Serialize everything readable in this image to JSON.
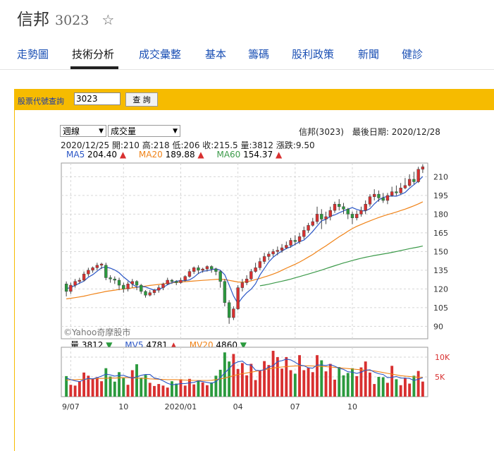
{
  "header": {
    "stock_name": "信邦",
    "stock_code": "3023"
  },
  "tabs": [
    {
      "label": "走勢圖",
      "active": false
    },
    {
      "label": "技術分析",
      "active": true
    },
    {
      "label": "成交彙整",
      "active": false
    },
    {
      "label": "基本",
      "active": false
    },
    {
      "label": "籌碼",
      "active": false
    },
    {
      "label": "股利政策",
      "active": false
    },
    {
      "label": "新聞",
      "active": false
    },
    {
      "label": "健診",
      "active": false
    }
  ],
  "query": {
    "label": "股票代號查詢",
    "value": "3023",
    "button": "查 詢"
  },
  "controls": {
    "period": "週線",
    "indicator": "成交量"
  },
  "info": {
    "title_date": "信邦(3023)　最後日期: 2020/12/28",
    "ohlc": "2020/12/25  開:210  高:218  低:206  收:215.5  量:3812  漲跌:9.50"
  },
  "ma_legend": [
    {
      "label": "MA5",
      "value": "204.40",
      "color": "#2a56c6",
      "dir": "▲"
    },
    {
      "label": "MA20",
      "value": "189.88",
      "color": "#f08318",
      "dir": "▲"
    },
    {
      "label": "MA60",
      "value": "154.37",
      "color": "#3c9a4a",
      "dir": "▲"
    }
  ],
  "vol_legend": [
    {
      "label": "量",
      "value": "3812",
      "color": "#222222",
      "dir": "▼"
    },
    {
      "label": "MV5",
      "value": "4781",
      "color": "#2a56c6",
      "dir": "▲"
    },
    {
      "label": "MV20",
      "value": "4860",
      "color": "#f08318",
      "dir": "▼"
    }
  ],
  "watermark": "©Yahoo奇摩股市",
  "colors": {
    "up": "#d83030",
    "down": "#2b9a3e",
    "query_bar": "#f6bb00",
    "tab_link": "#1a4fb4"
  },
  "chart_data": [
    {
      "type": "candlestick",
      "price_ticks": [
        90,
        105,
        120,
        135,
        150,
        165,
        180,
        195,
        210
      ],
      "ylim": [
        80,
        221
      ],
      "x_ticks": [
        "9/07",
        "10",
        "2020/01",
        "04",
        "07",
        "10"
      ],
      "grid": true,
      "candles": [
        [
          124,
          118,
          126,
          114
        ],
        [
          118,
          123,
          125,
          116
        ],
        [
          123,
          126,
          128,
          121
        ],
        [
          126,
          127,
          129,
          124
        ],
        [
          127,
          132,
          134,
          126
        ],
        [
          132,
          135,
          137,
          130
        ],
        [
          135,
          137,
          138,
          133
        ],
        [
          137,
          139,
          141,
          135
        ],
        [
          139,
          140,
          141,
          136
        ],
        [
          139,
          129,
          141,
          127
        ],
        [
          129,
          128,
          131,
          125
        ],
        [
          128,
          127,
          130,
          124
        ],
        [
          127,
          123,
          129,
          119
        ],
        [
          123,
          120,
          125,
          117
        ],
        [
          120,
          124,
          126,
          118
        ],
        [
          124,
          126,
          128,
          121
        ],
        [
          126,
          123,
          127,
          119
        ],
        [
          123,
          118,
          124,
          116
        ],
        [
          118,
          115,
          119,
          113
        ],
        [
          115,
          117,
          119,
          114
        ],
        [
          117,
          119,
          120,
          115
        ],
        [
          119,
          121,
          123,
          117
        ],
        [
          121,
          124,
          125,
          119
        ],
        [
          124,
          127,
          129,
          123
        ],
        [
          127,
          126,
          128,
          124
        ],
        [
          126,
          125,
          127,
          123
        ],
        [
          125,
          127,
          129,
          124
        ],
        [
          127,
          130,
          131,
          126
        ],
        [
          130,
          134,
          136,
          129
        ],
        [
          134,
          137,
          138,
          132
        ],
        [
          137,
          135,
          139,
          132
        ],
        [
          135,
          136,
          137,
          133
        ],
        [
          136,
          138,
          139,
          134
        ],
        [
          138,
          136,
          139,
          133
        ],
        [
          136,
          134,
          137,
          131
        ],
        [
          134,
          126,
          135,
          121
        ],
        [
          126,
          109,
          128,
          106
        ],
        [
          109,
          97,
          111,
          92
        ],
        [
          97,
          104,
          106,
          95
        ],
        [
          104,
          121,
          123,
          103
        ],
        [
          121,
          125,
          128,
          118
        ],
        [
          125,
          128,
          131,
          123
        ],
        [
          128,
          134,
          136,
          127
        ],
        [
          134,
          137,
          141,
          133
        ],
        [
          137,
          142,
          145,
          135
        ],
        [
          142,
          146,
          149,
          140
        ],
        [
          146,
          148,
          150,
          143
        ],
        [
          148,
          150,
          152,
          146
        ],
        [
          150,
          151,
          154,
          147
        ],
        [
          151,
          153,
          156,
          149
        ],
        [
          153,
          155,
          158,
          152
        ],
        [
          155,
          159,
          161,
          153
        ],
        [
          159,
          158,
          163,
          155
        ],
        [
          158,
          162,
          165,
          156
        ],
        [
          162,
          167,
          170,
          160
        ],
        [
          167,
          171,
          173,
          165
        ],
        [
          171,
          174,
          177,
          170
        ],
        [
          174,
          180,
          186,
          172
        ],
        [
          180,
          176,
          184,
          168
        ],
        [
          176,
          178,
          182,
          172
        ],
        [
          178,
          183,
          186,
          175
        ],
        [
          183,
          188,
          190,
          181
        ],
        [
          188,
          186,
          192,
          183
        ],
        [
          186,
          184,
          189,
          180
        ],
        [
          184,
          180,
          185,
          176
        ],
        [
          180,
          177,
          182,
          172
        ],
        [
          177,
          180,
          183,
          175
        ],
        [
          180,
          183,
          186,
          178
        ],
        [
          183,
          188,
          191,
          180
        ],
        [
          188,
          194,
          196,
          186
        ],
        [
          194,
          196,
          200,
          191
        ],
        [
          196,
          193,
          199,
          190
        ],
        [
          193,
          191,
          197,
          189
        ],
        [
          191,
          195,
          197,
          188
        ],
        [
          195,
          198,
          202,
          194
        ],
        [
          198,
          197,
          203,
          195
        ],
        [
          197,
          201,
          205,
          196
        ],
        [
          201,
          203,
          209,
          200
        ],
        [
          203,
          208,
          212,
          202
        ],
        [
          208,
          206,
          214,
          204
        ],
        [
          206,
          216,
          218,
          205
        ],
        [
          216,
          218,
          220,
          213
        ]
      ],
      "ma5": [
        120.1,
        121.2,
        122.8,
        124.6,
        126.2,
        129.4,
        131.4,
        134.2,
        137,
        137.6,
        136.6,
        135.2,
        133,
        129.6,
        126.8,
        123.8,
        121.5,
        121.8,
        121.6,
        120.2,
        119,
        119.4,
        121.2,
        123.4,
        125,
        126.2,
        126.6,
        126.6,
        127.3,
        129.4,
        132.4,
        134.2,
        134.6,
        135.4,
        136.2,
        135,
        131.4,
        123.2,
        114.4,
        108.2,
        113.1,
        116.9,
        119.8,
        124.1,
        131.2,
        136.4,
        141.6,
        145.4,
        148.2,
        150.4,
        152.4,
        153.8,
        155.8,
        157.8,
        159.2,
        162.4,
        166.2,
        170.4,
        174.6,
        175.8,
        178.2,
        179.4,
        181,
        182.6,
        184,
        185.2,
        183.8,
        182.8,
        182.6,
        184.4,
        188.2,
        191.4,
        193.4,
        194.2,
        194.6,
        194.4,
        195.8,
        197.4,
        200.8,
        203.6,
        206.6,
        210.2
      ],
      "ma20": [
        112,
        112.5,
        113,
        113.6,
        114.2,
        115,
        115.8,
        116.5,
        117.2,
        118,
        118.5,
        119,
        119.5,
        120,
        120.4,
        120.8,
        121.2,
        121.8,
        122.3,
        122.8,
        123.2,
        123.6,
        124,
        124.6,
        124.9,
        125.2,
        125.5,
        125.8,
        126.1,
        126.4,
        126.6,
        126.9,
        127.1,
        127.4,
        127.6,
        127.8,
        127.5,
        126.9,
        126.2,
        125.6,
        125.4,
        125.8,
        126.5,
        127.5,
        128.5,
        129.6,
        130.6,
        131.9,
        133.3,
        135,
        136.6,
        138.2,
        139.8,
        141.5,
        143.5,
        145.6,
        147.6,
        150,
        152.3,
        154.5,
        157,
        159.4,
        161.8,
        164,
        166.3,
        168.4,
        170.2,
        171.7,
        173.2,
        174.6,
        176,
        177.3,
        178.5,
        179.6,
        180.6,
        181.7,
        182.9,
        184,
        185.3,
        186.7,
        188.2,
        189.9
      ],
      "ma60": [
        null,
        null,
        null,
        null,
        null,
        null,
        null,
        null,
        null,
        null,
        null,
        null,
        null,
        null,
        null,
        null,
        null,
        null,
        null,
        null,
        null,
        null,
        null,
        null,
        null,
        null,
        null,
        null,
        null,
        null,
        null,
        null,
        null,
        null,
        null,
        null,
        null,
        null,
        null,
        null,
        null,
        null,
        null,
        null,
        122.5,
        123.1,
        123.8,
        124.6,
        125.4,
        126.2,
        127,
        127.9,
        128.9,
        129.9,
        130.9,
        131.9,
        133,
        134,
        135.1,
        136.3,
        137.5,
        138.6,
        139.7,
        140.8,
        141.8,
        142.8,
        143.7,
        144.6,
        145.4,
        146.1,
        146.8,
        147.4,
        148,
        148.6,
        149.3,
        150,
        150.8,
        151.5,
        152.3,
        153,
        153.6,
        154.4
      ],
      "volume": [
        5200,
        3000,
        2800,
        3900,
        6100,
        5300,
        4600,
        4900,
        3900,
        7200,
        5100,
        3800,
        6200,
        4700,
        3000,
        6700,
        8200,
        4800,
        5500,
        3500,
        2700,
        3200,
        2800,
        2300,
        3900,
        3300,
        4400,
        2800,
        4500,
        3100,
        4100,
        3600,
        2900,
        3600,
        5300,
        6800,
        11200,
        8900,
        10800,
        7000,
        8500,
        5400,
        8300,
        4200,
        6600,
        9000,
        8000,
        11600,
        10000,
        7100,
        10000,
        6700,
        5800,
        10500,
        6700,
        7300,
        6200,
        10500,
        9200,
        6400,
        8300,
        4300,
        7500,
        5400,
        6000,
        7200,
        5200,
        7400,
        8900,
        6100,
        3200,
        5000,
        4900,
        3500,
        7800,
        4400,
        2900,
        4700,
        3300,
        5300,
        6500,
        3812
      ],
      "vol_ticks": [
        5000,
        10000
      ],
      "vol_tick_labels": [
        "5K",
        "10K"
      ],
      "vol_ylim": [
        0,
        12500
      ],
      "mv5": [
        4700,
        4300,
        4000,
        3800,
        4300,
        4600,
        4500,
        4800,
        5200,
        5700,
        5500,
        5200,
        5400,
        5400,
        5000,
        4700,
        5000,
        5400,
        5600,
        5600,
        4700,
        4500,
        4000,
        3400,
        3000,
        3100,
        3300,
        3300,
        3500,
        3600,
        4000,
        3800,
        3600,
        3400,
        3800,
        4800,
        6000,
        7100,
        8300,
        8800,
        9000,
        8100,
        8000,
        6700,
        6600,
        6800,
        7500,
        7800,
        8900,
        9100,
        9500,
        9300,
        8700,
        8000,
        7800,
        7300,
        7200,
        8000,
        8000,
        7900,
        8100,
        7700,
        7200,
        6900,
        6300,
        6200,
        5900,
        6200,
        6700,
        6800,
        6200,
        5800,
        5600,
        4800,
        4900,
        5100,
        4700,
        4700,
        4600,
        4100,
        4400,
        4781
      ],
      "mv20": [
        4200,
        4250,
        4300,
        4350,
        4400,
        4450,
        4500,
        4550,
        4600,
        4650,
        4700,
        4700,
        4750,
        4800,
        4800,
        4750,
        4700,
        4650,
        4600,
        4500,
        4450,
        4400,
        4350,
        4300,
        4300,
        4300,
        4250,
        4200,
        4150,
        4100,
        4100,
        4100,
        4100,
        4150,
        4300,
        4500,
        4700,
        5000,
        5300,
        5600,
        5800,
        6000,
        6200,
        6400,
        6600,
        6800,
        7000,
        7200,
        7400,
        7500,
        7600,
        7700,
        7750,
        7800,
        7800,
        7800,
        7750,
        7700,
        7650,
        7600,
        7500,
        7400,
        7300,
        7200,
        7100,
        7000,
        6900,
        6800,
        6700,
        6600,
        6500,
        6300,
        6100,
        5900,
        5700,
        5500,
        5300,
        5200,
        5100,
        5000,
        4900,
        4860
      ]
    }
  ]
}
